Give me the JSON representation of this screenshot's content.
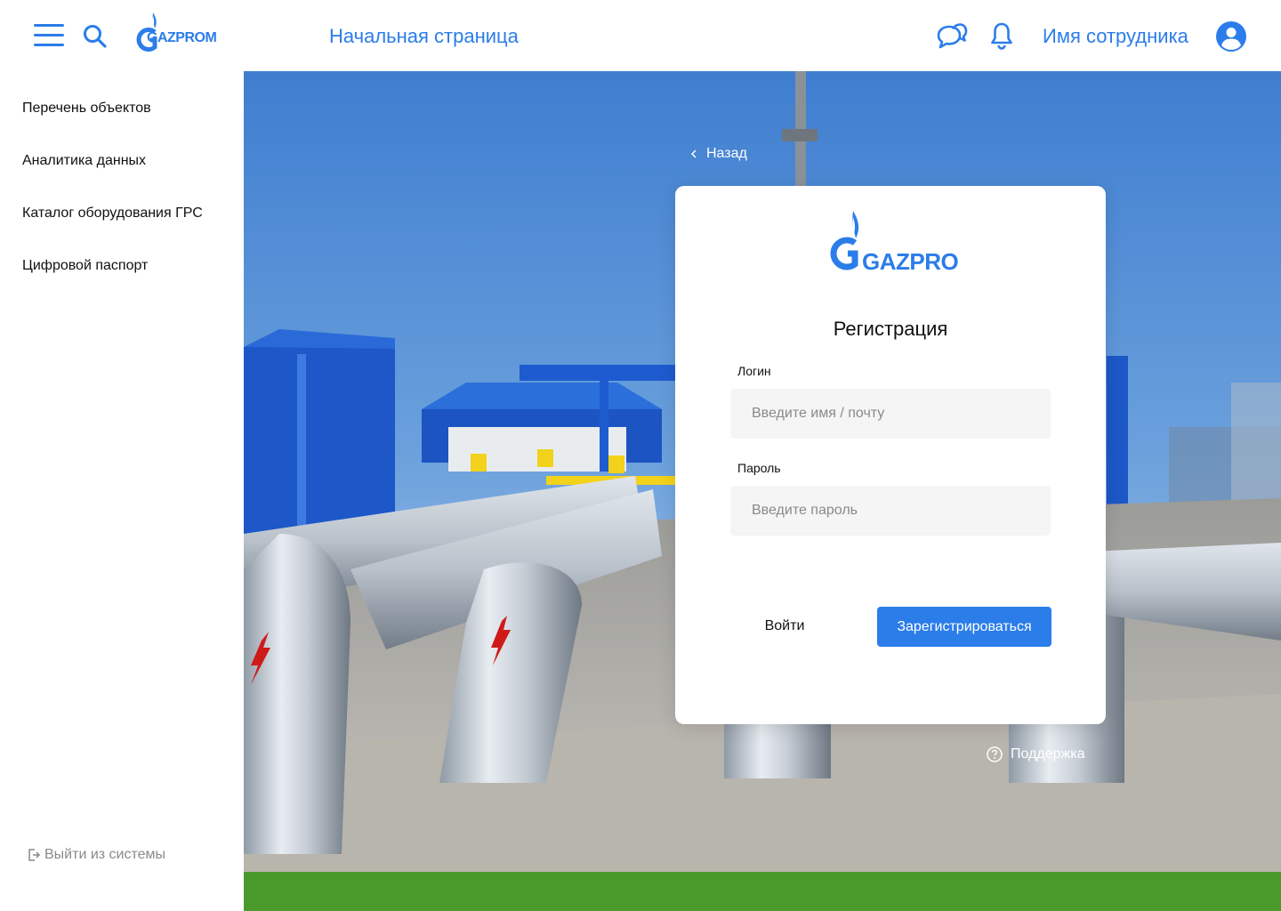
{
  "header": {
    "logo_text": "GAZPROM",
    "page_title": "Начальная страница",
    "user_name": "Имя сотрудника"
  },
  "sidebar": {
    "items": [
      {
        "label": "Перечень объектов"
      },
      {
        "label": "Аналитика данных"
      },
      {
        "label": "Каталог оборудования ГРС"
      },
      {
        "label": "Цифровой паспорт"
      }
    ],
    "logout_label": "Выйти из системы"
  },
  "main": {
    "back_label": "Назад",
    "support_label": "Поддержка"
  },
  "form": {
    "logo_text": "GAZPROM",
    "title": "Регистрация",
    "login_label": "Логин",
    "login_placeholder": "Введите имя / почту",
    "password_label": "Пароль",
    "password_placeholder": "Введите пароль",
    "login_button": "Войти",
    "register_button": "Зарегистрироваться"
  },
  "colors": {
    "accent": "#2b7de9",
    "field_bg": "#f5f5f5",
    "muted": "#8a8a8a"
  }
}
